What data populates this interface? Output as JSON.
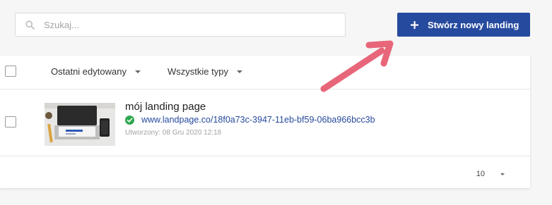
{
  "search": {
    "placeholder": "Szukaj..."
  },
  "header": {
    "create_label": "Stwórz nowy landing"
  },
  "toolbar": {
    "sort_label": "Ostatni edytowany",
    "type_label": "Wszystkie typy"
  },
  "landings": [
    {
      "title": "mój landing page",
      "url": "www.landpage.co/18f0a73c-3947-11eb-bf59-06ba966bcc3b",
      "created": "Utworzony: 08 Gru 2020 12:18",
      "status": "published"
    }
  ],
  "pagination": {
    "per_page": "10"
  },
  "colors": {
    "primary": "#264a9e",
    "success": "#2fa84f",
    "arrow": "#e8667a"
  },
  "icons": {
    "search": "search-icon",
    "plus": "plus-icon",
    "check": "check-circle-icon",
    "caret": "caret-down-icon"
  }
}
